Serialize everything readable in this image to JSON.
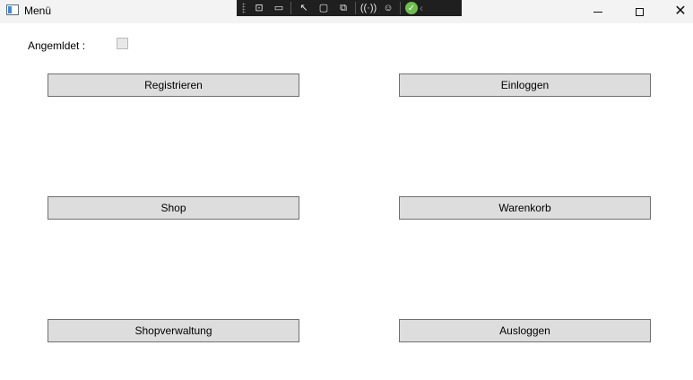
{
  "window": {
    "title": "Menü"
  },
  "caption_buttons": {
    "minimize": "—",
    "maximize": "☐",
    "close": "✕"
  },
  "debug_toolbar": {
    "icons": [
      "select-element-icon",
      "video-icon",
      "pointer-icon",
      "bounds-icon",
      "track-focus-icon",
      "hot-reload-icon",
      "accessibility-icon",
      "status-ok-icon",
      "collapse-chevron-icon"
    ]
  },
  "form": {
    "logged_in_label": "Angemldet :",
    "logged_in_checked": false
  },
  "buttons": {
    "register": "Registrieren",
    "login": "Einloggen",
    "shop": "Shop",
    "cart": "Warenkorb",
    "shop_admin": "Shopverwaltung",
    "logout": "Ausloggen"
  }
}
